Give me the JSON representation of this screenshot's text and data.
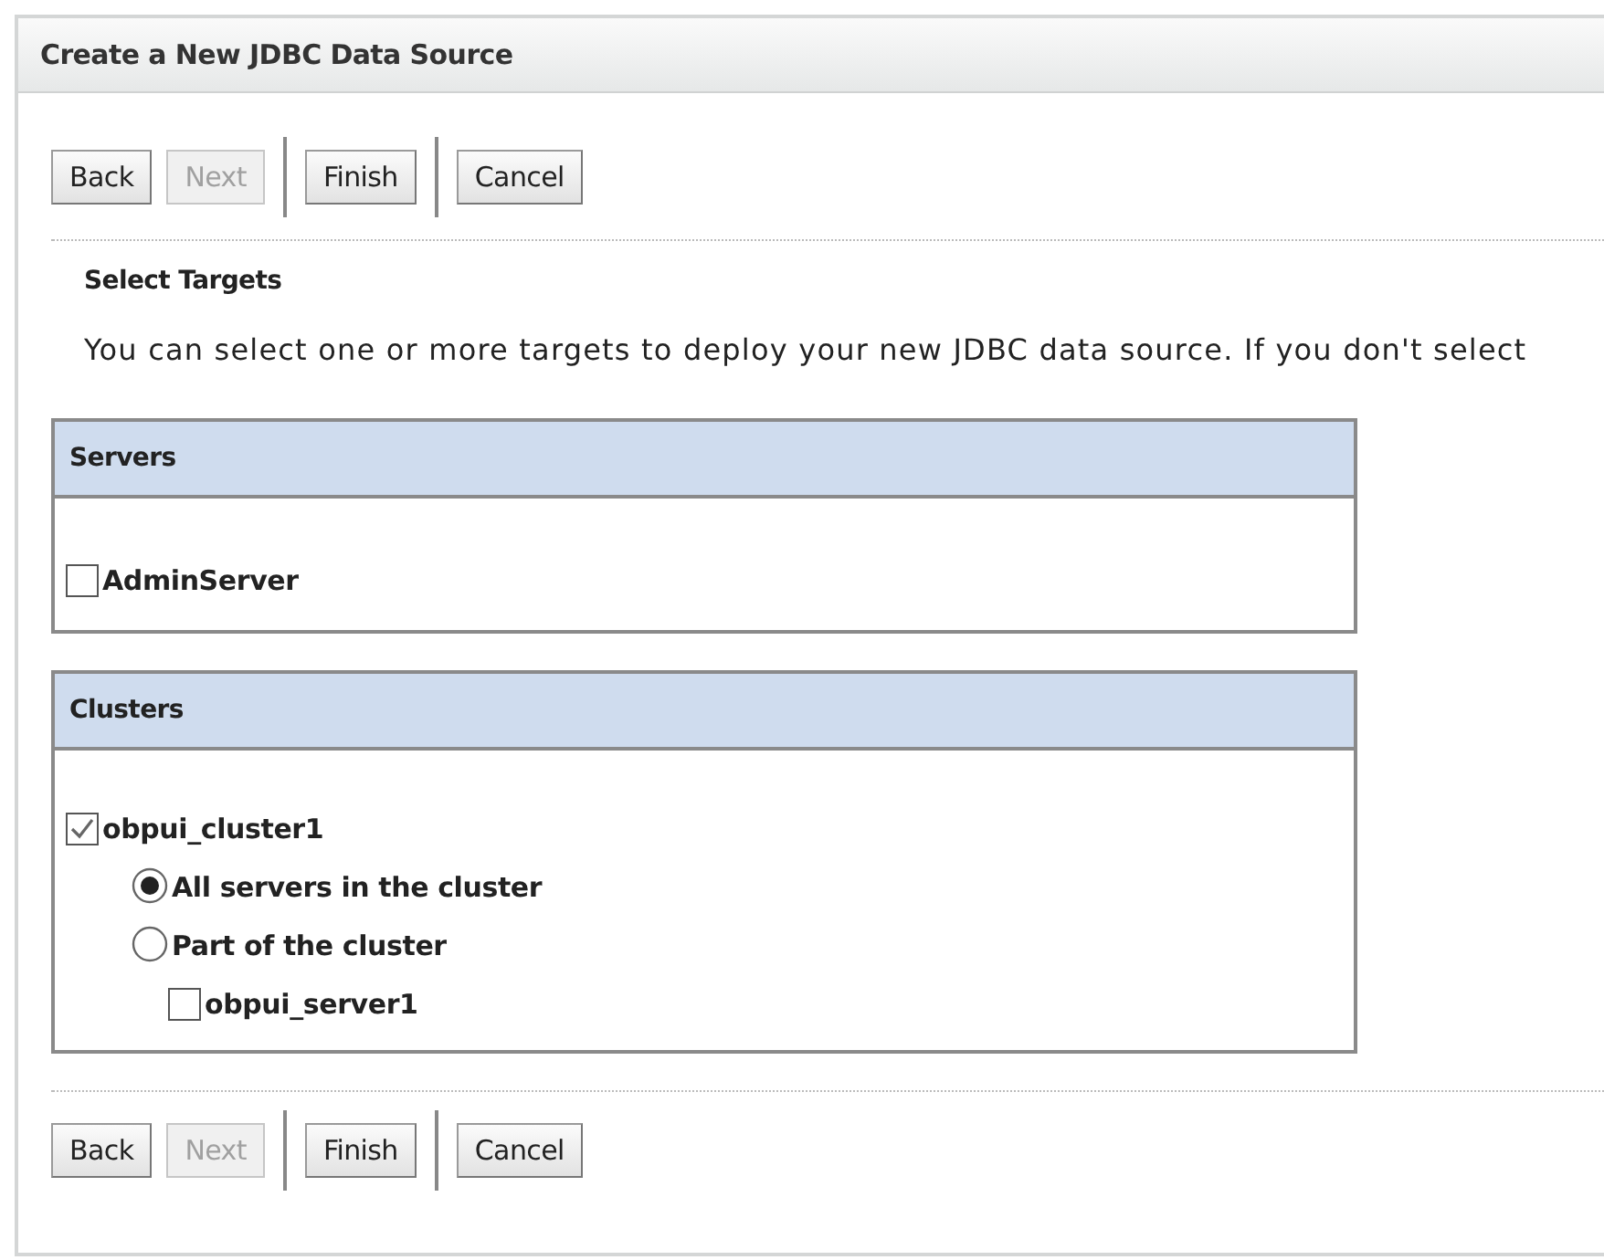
{
  "title": "Create a New JDBC Data Source",
  "top_buttons": [
    [
      {
        "label": "Back",
        "disabled": false
      },
      {
        "label": "Next",
        "disabled": true
      }
    ],
    [
      {
        "label": "Finish",
        "disabled": false
      }
    ],
    [
      {
        "label": "Cancel",
        "disabled": false
      }
    ]
  ],
  "section_title": "Select Targets",
  "description": "You can select one or more targets to deploy your new JDBC data source. If you don't select",
  "servers": {
    "heading": "Servers",
    "items": [
      {
        "label": "AdminServer",
        "checked": false
      }
    ]
  },
  "clusters": {
    "heading": "Clusters",
    "items": [
      {
        "label": "obpui_cluster1",
        "checked": true,
        "options": [
          {
            "label": "All servers in the cluster",
            "selected": true
          },
          {
            "label": "Part of the cluster",
            "selected": false,
            "servers": [
              {
                "label": "obpui_server1",
                "checked": false
              }
            ]
          }
        ]
      }
    ]
  },
  "bottom_buttons": [
    [
      {
        "label": "Back",
        "disabled": false
      },
      {
        "label": "Next",
        "disabled": true
      }
    ],
    [
      {
        "label": "Finish",
        "disabled": false
      }
    ],
    [
      {
        "label": "Cancel",
        "disabled": false
      }
    ]
  ]
}
